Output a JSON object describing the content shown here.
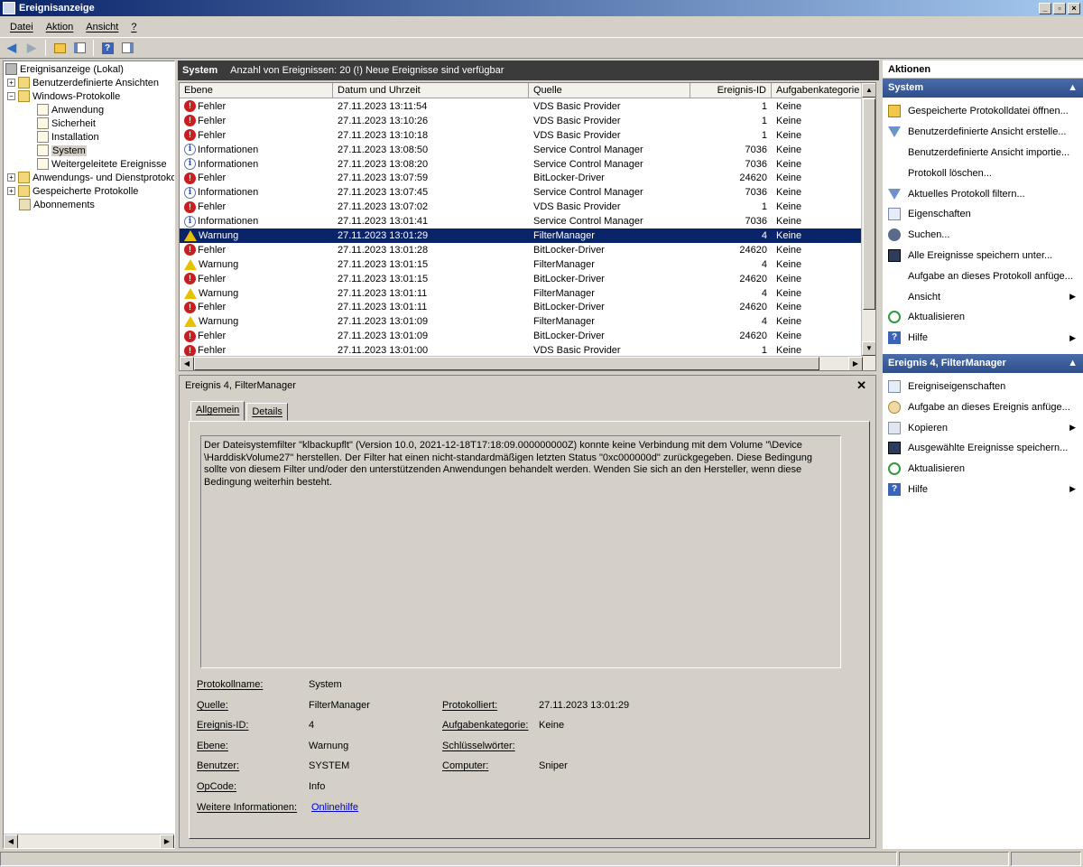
{
  "window": {
    "title": "Ereignisanzeige",
    "buttons": [
      "_",
      "▫",
      "×"
    ]
  },
  "menu": [
    "Datei",
    "Aktion",
    "Ansicht",
    "?"
  ],
  "toolbar": {
    "back": "back-arrow-icon",
    "forward": "forward-arrow-icon",
    "up": "folder-up-icon",
    "show_tree": "console-tree-icon",
    "help": "help-icon",
    "show_actions": "action-pane-icon"
  },
  "tree": {
    "root": "Ereignisanzeige (Lokal)",
    "custom_views": "Benutzerdefinierte Ansichten",
    "windows_logs": "Windows-Protokolle",
    "logs": [
      "Anwendung",
      "Sicherheit",
      "Installation",
      "System",
      "Weitergeleitete Ereignisse"
    ],
    "apps_services": "Anwendungs- und Dienstprotokol",
    "saved_logs": "Gespeicherte Protokolle",
    "subscriptions": "Abonnements"
  },
  "center": {
    "log_name": "System",
    "summary": "Anzahl von Ereignissen: 20 (!) Neue Ereignisse sind verfügbar",
    "columns": [
      "Ebene",
      "Datum und Uhrzeit",
      "Quelle",
      "Ereignis-ID",
      "Aufgabenkategorie"
    ],
    "rows": [
      {
        "level": "Fehler",
        "icon": "error",
        "date": "27.11.2023 13:11:54",
        "source": "VDS Basic Provider",
        "id": "1",
        "task": "Keine"
      },
      {
        "level": "Fehler",
        "icon": "error",
        "date": "27.11.2023 13:10:26",
        "source": "VDS Basic Provider",
        "id": "1",
        "task": "Keine"
      },
      {
        "level": "Fehler",
        "icon": "error",
        "date": "27.11.2023 13:10:18",
        "source": "VDS Basic Provider",
        "id": "1",
        "task": "Keine"
      },
      {
        "level": "Informationen",
        "icon": "info",
        "date": "27.11.2023 13:08:50",
        "source": "Service Control Manager",
        "id": "7036",
        "task": "Keine"
      },
      {
        "level": "Informationen",
        "icon": "info",
        "date": "27.11.2023 13:08:20",
        "source": "Service Control Manager",
        "id": "7036",
        "task": "Keine"
      },
      {
        "level": "Fehler",
        "icon": "error",
        "date": "27.11.2023 13:07:59",
        "source": "BitLocker-Driver",
        "id": "24620",
        "task": "Keine"
      },
      {
        "level": "Informationen",
        "icon": "info",
        "date": "27.11.2023 13:07:45",
        "source": "Service Control Manager",
        "id": "7036",
        "task": "Keine"
      },
      {
        "level": "Fehler",
        "icon": "error",
        "date": "27.11.2023 13:07:02",
        "source": "VDS Basic Provider",
        "id": "1",
        "task": "Keine"
      },
      {
        "level": "Informationen",
        "icon": "info",
        "date": "27.11.2023 13:01:41",
        "source": "Service Control Manager",
        "id": "7036",
        "task": "Keine"
      },
      {
        "level": "Warnung",
        "icon": "warning",
        "date": "27.11.2023 13:01:29",
        "source": "FilterManager",
        "id": "4",
        "task": "Keine",
        "selected": true
      },
      {
        "level": "Fehler",
        "icon": "error",
        "date": "27.11.2023 13:01:28",
        "source": "BitLocker-Driver",
        "id": "24620",
        "task": "Keine"
      },
      {
        "level": "Warnung",
        "icon": "warning",
        "date": "27.11.2023 13:01:15",
        "source": "FilterManager",
        "id": "4",
        "task": "Keine"
      },
      {
        "level": "Fehler",
        "icon": "error",
        "date": "27.11.2023 13:01:15",
        "source": "BitLocker-Driver",
        "id": "24620",
        "task": "Keine"
      },
      {
        "level": "Warnung",
        "icon": "warning",
        "date": "27.11.2023 13:01:11",
        "source": "FilterManager",
        "id": "4",
        "task": "Keine"
      },
      {
        "level": "Fehler",
        "icon": "error",
        "date": "27.11.2023 13:01:11",
        "source": "BitLocker-Driver",
        "id": "24620",
        "task": "Keine"
      },
      {
        "level": "Warnung",
        "icon": "warning",
        "date": "27.11.2023 13:01:09",
        "source": "FilterManager",
        "id": "4",
        "task": "Keine"
      },
      {
        "level": "Fehler",
        "icon": "error",
        "date": "27.11.2023 13:01:09",
        "source": "BitLocker-Driver",
        "id": "24620",
        "task": "Keine"
      },
      {
        "level": "Fehler",
        "icon": "error",
        "date": "27.11.2023 13:01:00",
        "source": "VDS Basic Provider",
        "id": "1",
        "task": "Keine"
      }
    ]
  },
  "details": {
    "title": "Ereignis 4, FilterManager",
    "tabs": [
      "Allgemein",
      "Details"
    ],
    "description": "Der Dateisystemfilter \"klbackupflt\" (Version 10.0, 2021-12-18T17:18:09.000000000Z) konnte keine Verbindung mit dem Volume \"\\Device \\HarddiskVolume27\" herstellen. Der Filter hat einen nicht-standardmäßigen letzten Status \"0xc000000d\" zurückgegeben. Diese Bedingung sollte von diesem Filter und/oder den unterstützenden Anwendungen behandelt werden. Wenden Sie sich an den Hersteller, wenn diese Bedingung weiterhin besteht.",
    "labels": {
      "log_name": "Protokollname:",
      "source": "Quelle:",
      "event_id": "Ereignis-ID:",
      "level": "Ebene:",
      "user": "Benutzer:",
      "opcode": "OpCode:",
      "more_info": "Weitere Informationen:",
      "logged": "Protokolliert:",
      "task_category": "Aufgabenkategorie:",
      "keywords": "Schlüsselwörter:",
      "computer": "Computer:"
    },
    "values": {
      "log_name": "System",
      "source": "FilterManager",
      "event_id": "4",
      "level": "Warnung",
      "user": "SYSTEM",
      "opcode": "Info",
      "more_info": "Onlinehilfe",
      "logged": "27.11.2023 13:01:29",
      "task_category": "Keine",
      "keywords": "",
      "computer": "Sniper"
    }
  },
  "actions": {
    "header": "Aktionen",
    "section1": "System",
    "section1_items": [
      "Gespeicherte Protokolldatei öffnen...",
      "Benutzerdefinierte Ansicht erstelle...",
      "Benutzerdefinierte Ansicht importie...",
      "Protokoll löschen...",
      "Aktuelles Protokoll filtern...",
      "Eigenschaften",
      "Suchen...",
      "Alle Ereignisse speichern unter...",
      "Aufgabe an dieses Protokoll anfüge...",
      "Ansicht",
      "Aktualisieren",
      "Hilfe"
    ],
    "section2": "Ereignis 4, FilterManager",
    "section2_items": [
      "Ereigniseigenschaften",
      "Aufgabe an dieses Ereignis anfüge...",
      "Kopieren",
      "Ausgewählte Ereignisse speichern...",
      "Aktualisieren",
      "Hilfe"
    ]
  }
}
